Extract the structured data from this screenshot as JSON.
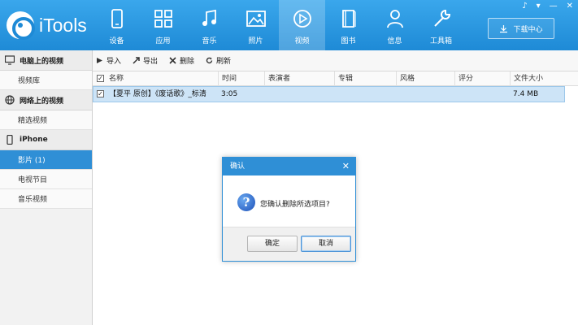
{
  "app": {
    "name": "iTools"
  },
  "window_controls": [
    "♪",
    "▾",
    "—",
    "✕"
  ],
  "nav": [
    {
      "label": "设备",
      "icon": "phone-icon"
    },
    {
      "label": "应用",
      "icon": "apps-grid-icon"
    },
    {
      "label": "音乐",
      "icon": "music-note-icon"
    },
    {
      "label": "照片",
      "icon": "photo-icon"
    },
    {
      "label": "视频",
      "icon": "play-circle-icon",
      "active": true
    },
    {
      "label": "图书",
      "icon": "book-icon"
    },
    {
      "label": "信息",
      "icon": "person-icon"
    },
    {
      "label": "工具箱",
      "icon": "wrench-icon"
    }
  ],
  "download_center": {
    "label": "下载中心",
    "icon": "download-icon"
  },
  "sidebar": {
    "sections": [
      {
        "title": "电脑上的视频",
        "icon": "monitor-icon",
        "items": [
          "视频库"
        ]
      },
      {
        "title": "网络上的视频",
        "icon": "globe-icon",
        "items": [
          "精选视频"
        ]
      },
      {
        "title": "iPhone",
        "icon": "iphone-icon",
        "items": [
          "影片 (1)",
          "电视节目",
          "音乐视频"
        ]
      }
    ],
    "active_item": "影片 (1)"
  },
  "toolbar": {
    "import_label": "导入",
    "export_label": "导出",
    "delete_label": "删除",
    "refresh_label": "刷新"
  },
  "table": {
    "columns": [
      "名称",
      "时间",
      "表演者",
      "专辑",
      "风格",
      "评分",
      "文件大小"
    ],
    "rows": [
      {
        "name": "【夏平 原创】《废话歌》_标清",
        "time": "3:05",
        "artist": "",
        "album": "",
        "genre": "",
        "rating": "",
        "size": "7.4 MB",
        "checked": true
      }
    ]
  },
  "dialog": {
    "title": "确认",
    "message": "您确认删除所选项目?",
    "ok_label": "确定",
    "cancel_label": "取消",
    "close_symbol": "✕",
    "icon": "question-icon"
  }
}
